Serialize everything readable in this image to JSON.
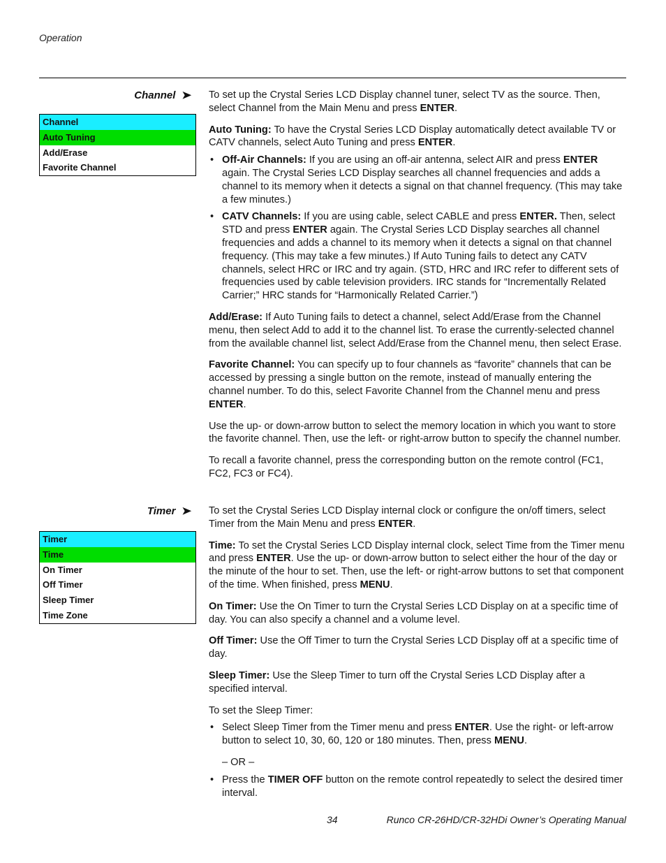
{
  "header": {
    "running_head": "Operation"
  },
  "footer": {
    "page_number": "34",
    "manual_title": "Runco CR-26HD/CR-32HDi Owner’s Operating Manual"
  },
  "sections": {
    "channel": {
      "heading": "Channel",
      "arrow_icon": "➤",
      "menu": {
        "title": "Channel",
        "items": [
          "Auto Tuning",
          "Add/Erase",
          "Favorite Channel"
        ],
        "selected": "Auto Tuning"
      },
      "intro": {
        "text": "To set up the Crystal Series LCD Display channel tuner, select TV as the source. Then, select Channel from the Main Menu and press ",
        "bold": "ENTER",
        "end": "."
      },
      "auto_tuning": {
        "label": "Auto Tuning:",
        "text": " To have the Crystal Series LCD Display automatically detect available TV or CATV channels, select Auto Tuning and press ",
        "bold": "ENTER",
        "end": "."
      },
      "off_air": {
        "label": "Off-Air Channels:",
        "text": " If you are using an off-air antenna, select AIR and press ",
        "bold": "ENTER",
        "end": " again. The Crystal Series LCD Display searches all channel frequencies and adds a channel to its memory when it detects a signal on that channel frequency. (This may take a few minutes.)"
      },
      "catv": {
        "label": "CATV Channels:",
        "text1": " If you are using cable, select CABLE and press ",
        "bold1": "ENTER.",
        "text2": " Then, select STD and press ",
        "bold2": "ENTER",
        "text3": " again. The Crystal Series LCD Display searches all channel frequencies and adds a channel to its memory when it detects a signal on that channel frequency. (This may take a few minutes.) If Auto Tuning fails to detect any CATV channels, select HRC or IRC and try again. (STD, HRC and IRC refer to different sets of frequencies used by cable television providers. IRC stands for “Incrementally Related Carrier;” HRC stands for “Harmonically Related Carrier.”)"
      },
      "add_erase": {
        "label": "Add/Erase:",
        "text": " If Auto Tuning fails to detect a channel, select Add/Erase from the Channel menu, then select Add to add it to the channel list. To erase the currently-selected channel from the available channel list, select Add/Erase from the Channel menu, then select Erase."
      },
      "favorite": {
        "label": "Favorite Channel:",
        "text": " You can specify up to four channels as “favorite” channels that can be accessed by pressing a single button on the remote, instead of manually entering the channel number. To do this, select Favorite Channel from the Channel menu and press ",
        "bold": "ENTER",
        "end": "."
      },
      "favorite_p2": "Use the up- or down-arrow button to select the memory location in which you want to store the favorite channel. Then, use the left- or right-arrow button to specify the channel number.",
      "favorite_p3": "To recall a favorite channel, press the corresponding button on the remote control (FC1, FC2, FC3 or FC4)."
    },
    "timer": {
      "heading": "Timer",
      "arrow_icon": "➤",
      "menu": {
        "title": "Timer",
        "items": [
          "Time",
          "On Timer",
          "Off Timer",
          "Sleep Timer",
          "Time Zone"
        ],
        "selected": "Time"
      },
      "intro": {
        "text": "To set the Crystal Series LCD Display internal clock or configure the on/off timers, select Timer from the Main Menu and press ",
        "bold": "ENTER",
        "end": "."
      },
      "time": {
        "label": "Time:",
        "text1": " To set the Crystal Series LCD Display internal clock, select Time from the Timer menu and press ",
        "bold1": "ENTER",
        "text2": ". Use the up- or down-arrow button to select either the hour of the day or the minute of the hour to set. Then, use the left- or right-arrow buttons to set that component of the time. When finished, press ",
        "bold2": "MENU",
        "end": "."
      },
      "on_timer": {
        "label": "On Timer:",
        "text": " Use the On Timer to turn the Crystal Series LCD Display on at a specific time of day. You can also specify a channel and a volume level."
      },
      "off_timer": {
        "label": "Off Timer:",
        "text": " Use the Off Timer to turn the Crystal Series LCD Display off at a specific time of day."
      },
      "sleep_timer": {
        "label": "Sleep Timer:",
        "text": " Use the Sleep Timer to turn off the Crystal Series LCD Display after a specified interval."
      },
      "sleep_intro": "To set the Sleep Timer:",
      "sleep_b1": {
        "text1": "Select Sleep Timer from the Timer menu and press ",
        "bold1": "ENTER",
        "text2": ". Use the right- or left-arrow button to select 10, 30, 60, 120 or 180 minutes. Then, press ",
        "bold2": "MENU",
        "end": "."
      },
      "or": "– OR –",
      "sleep_b2": {
        "text1": "Press the ",
        "bold1": "TIMER OFF",
        "text2": " button on the remote control repeatedly to select the desired timer interval."
      }
    }
  }
}
